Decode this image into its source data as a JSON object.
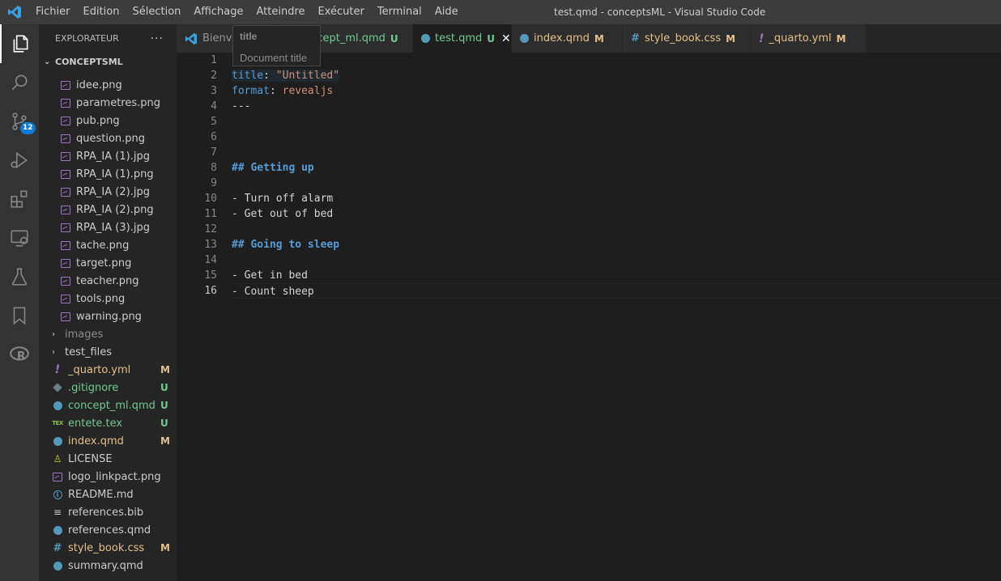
{
  "menu": [
    "Fichier",
    "Edition",
    "Sélection",
    "Affichage",
    "Atteindre",
    "Exécuter",
    "Terminal",
    "Aide"
  ],
  "window_title": "test.qmd - conceptsML - Visual Studio Code",
  "activity_bar": {
    "source_control_badge": "12"
  },
  "sidebar": {
    "header": "EXPLORATEUR",
    "more": "···",
    "section": "CONCEPTSML",
    "items": [
      {
        "name": "idee.png",
        "icon": "image-icon",
        "status": ""
      },
      {
        "name": "parametres.png",
        "icon": "image-icon",
        "status": ""
      },
      {
        "name": "pub.png",
        "icon": "image-icon",
        "status": ""
      },
      {
        "name": "question.png",
        "icon": "image-icon",
        "status": ""
      },
      {
        "name": "RPA_IA (1).jpg",
        "icon": "image-icon",
        "status": ""
      },
      {
        "name": "RPA_IA (1).png",
        "icon": "image-icon",
        "status": ""
      },
      {
        "name": "RPA_IA (2).jpg",
        "icon": "image-icon",
        "status": ""
      },
      {
        "name": "RPA_IA (2).png",
        "icon": "image-icon",
        "status": ""
      },
      {
        "name": "RPA_IA (3).jpg",
        "icon": "image-icon",
        "status": ""
      },
      {
        "name": "tache.png",
        "icon": "image-icon",
        "status": ""
      },
      {
        "name": "target.png",
        "icon": "image-icon",
        "status": ""
      },
      {
        "name": "teacher.png",
        "icon": "image-icon",
        "status": ""
      },
      {
        "name": "tools.png",
        "icon": "image-icon",
        "status": ""
      },
      {
        "name": "warning.png",
        "icon": "image-icon",
        "status": ""
      },
      {
        "name": "images",
        "icon": "folder-chevron-icon",
        "status": ""
      },
      {
        "name": "test_files",
        "icon": "folder-chevron-icon",
        "status": ""
      },
      {
        "name": "_quarto.yml",
        "icon": "yaml-icon",
        "status": "M"
      },
      {
        "name": ".gitignore",
        "icon": "git-icon",
        "status": "U"
      },
      {
        "name": "concept_ml.qmd",
        "icon": "quarto-icon",
        "status": "U"
      },
      {
        "name": "entete.tex",
        "icon": "tex-icon",
        "status": "U"
      },
      {
        "name": "index.qmd",
        "icon": "quarto-icon",
        "status": "M"
      },
      {
        "name": "LICENSE",
        "icon": "license-icon",
        "status": ""
      },
      {
        "name": "logo_linkpact.png",
        "icon": "image-icon",
        "status": ""
      },
      {
        "name": "README.md",
        "icon": "info-icon",
        "status": ""
      },
      {
        "name": "references.bib",
        "icon": "lines-icon",
        "status": ""
      },
      {
        "name": "references.qmd",
        "icon": "quarto-icon",
        "status": ""
      },
      {
        "name": "style_book.css",
        "icon": "css-icon",
        "status": "M"
      },
      {
        "name": "summary.qmd",
        "icon": "quarto-icon",
        "status": ""
      }
    ]
  },
  "tabs": [
    {
      "label": "Bienvenue",
      "status": "",
      "icon": "vscode-icon"
    },
    {
      "label": "concept_ml.qmd",
      "status": "U",
      "icon": "quarto-icon"
    },
    {
      "label": "test.qmd",
      "status": "U",
      "icon": "quarto-icon",
      "close": "✕"
    },
    {
      "label": "index.qmd",
      "status": "M",
      "icon": "quarto-icon"
    },
    {
      "label": "style_book.css",
      "status": "M",
      "icon": "css-icon"
    },
    {
      "label": "_quarto.yml",
      "status": "M",
      "icon": "yaml-icon"
    }
  ],
  "hover": {
    "title": "title",
    "description": "Document title"
  },
  "editor": {
    "current_line": 16,
    "line_numbers": [
      "1",
      "2",
      "3",
      "4",
      "5",
      "6",
      "7",
      "8",
      "9",
      "10",
      "11",
      "12",
      "13",
      "14",
      "15",
      "16"
    ],
    "lines": {
      "l1": "---",
      "l2_key": "title",
      "l2_sep": ": ",
      "l2_val": "\"Untitled\"",
      "l3_key": "format",
      "l3_sep": ": ",
      "l3_val": "revealjs",
      "l4": "---",
      "l8": "## Getting up",
      "l10": "- Turn off alarm",
      "l11": "- Get out of bed",
      "l13": "## Going to sleep",
      "l15": "- Get in bed",
      "l16": "- Count sheep"
    }
  },
  "colors": {
    "accent": "#0e7ad3",
    "modified": "#e2c08d",
    "untracked": "#73c991"
  }
}
